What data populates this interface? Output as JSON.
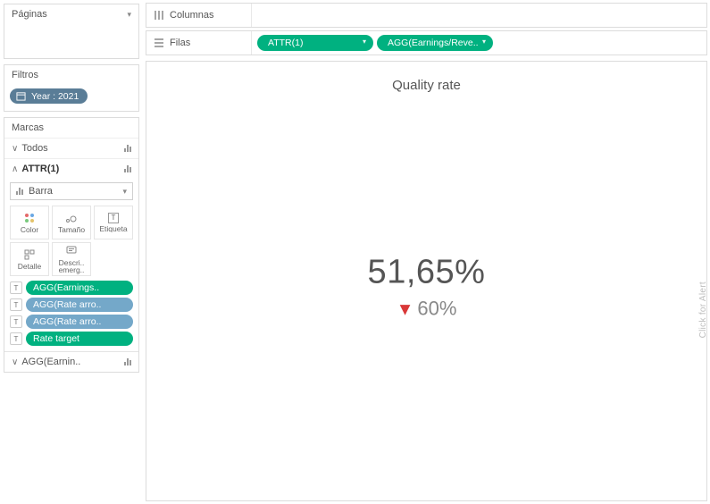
{
  "pages": {
    "title": "Páginas"
  },
  "filters": {
    "title": "Filtros",
    "pill": "Year : 2021"
  },
  "marks": {
    "title": "Marcas",
    "all": "Todos",
    "attr": "ATTR(1)",
    "dropdown": "Barra",
    "buttons": {
      "color": "Color",
      "size": "Tamaño",
      "label": "Etiqueta",
      "detail": "Detalle",
      "tooltip": "Descri.. emerg.."
    },
    "pills": [
      {
        "label": "AGG(Earnings..",
        "cls": "green"
      },
      {
        "label": "AGG(Rate arro..",
        "cls": "blue"
      },
      {
        "label": "AGG(Rate arro..",
        "cls": "blue"
      },
      {
        "label": "Rate target",
        "cls": "green"
      }
    ],
    "agg_collapsed": "AGG(Earnin.."
  },
  "shelves": {
    "columns": "Columnas",
    "rows": "Filas",
    "row_pills": [
      "ATTR(1)",
      "AGG(Earnings/Reve.."
    ]
  },
  "viz": {
    "title": "Quality rate",
    "value": "51,65%",
    "target": "60%",
    "alert": "Click for Alert"
  }
}
